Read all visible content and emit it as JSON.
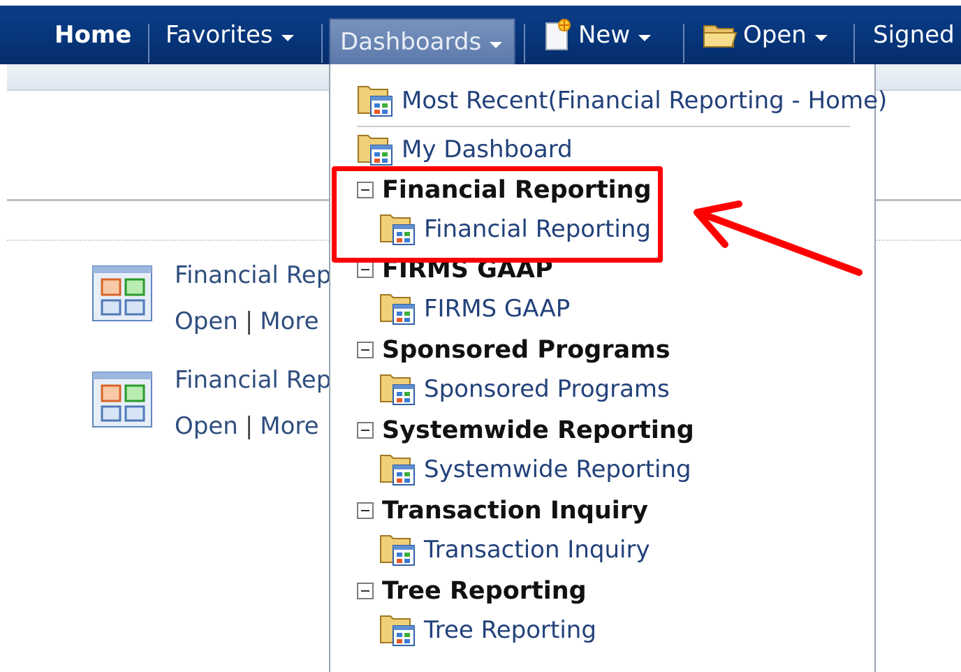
{
  "nav": {
    "home": "Home",
    "favorites": "Favorites",
    "dashboards": "Dashboards",
    "new": "New",
    "open": "Open",
    "signed_in": "Signed I"
  },
  "cards": [
    {
      "title": "Financial Repo",
      "open": "Open",
      "separator": "|",
      "more": "More"
    },
    {
      "title": "Financial Repo",
      "open": "Open",
      "separator": "|",
      "more": "More"
    }
  ],
  "menu": {
    "most_recent": "Most Recent(Financial Reporting - Home)",
    "my_dashboard": "My Dashboard",
    "groups": [
      {
        "heading": "Financial Reporting",
        "item": "Financial Reporting"
      },
      {
        "heading": "FIRMS GAAP",
        "item": "FIRMS GAAP"
      },
      {
        "heading": "Sponsored Programs",
        "item": "Sponsored Programs"
      },
      {
        "heading": "Systemwide Reporting",
        "item": "Systemwide Reporting"
      },
      {
        "heading": "Transaction Inquiry",
        "item": "Transaction Inquiry"
      },
      {
        "heading": "Tree Reporting",
        "item": "Tree Reporting"
      }
    ]
  },
  "colors": {
    "nav_background": "#073479",
    "link": "#22417a",
    "highlight": "#ff0000"
  }
}
